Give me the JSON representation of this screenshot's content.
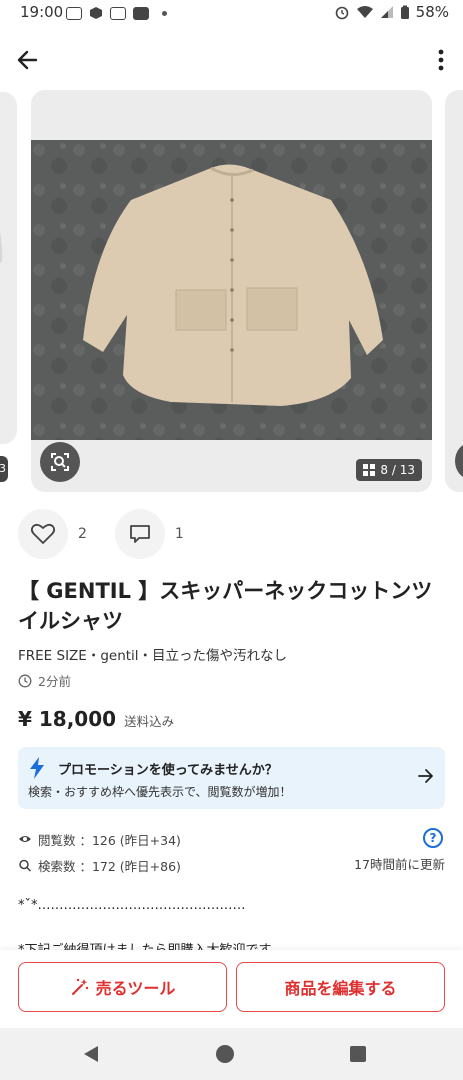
{
  "status_bar": {
    "time": "19:00",
    "battery": "58%"
  },
  "app_bar": {
    "back_icon": "arrow-left-icon",
    "more_icon": "more-vert-icon"
  },
  "carousel": {
    "prev_counter_fragment": "3",
    "counter": "8 / 13",
    "grid_icon": "grid-icon",
    "lens_icon": "image-search-icon"
  },
  "social": {
    "likes": "2",
    "comments": "1"
  },
  "item": {
    "title": "【 GENTIL 】スキッパーネックコットンツイルシャツ",
    "subinfo": "FREE SIZE・gentil・目立った傷や汚れなし",
    "posted": "2分前",
    "price": "¥ 18,000",
    "shipping": "送料込み"
  },
  "promo": {
    "title": "プロモーションを使ってみませんか？",
    "desc": "検索・おすすめ枠へ優先表示で、閲覧数が増加！"
  },
  "stats": {
    "views": "閲覧数 ：126 (昨日+34)",
    "searches": "検索数 ：172 (昨日+86)",
    "updated": "17時間前に更新"
  },
  "description": {
    "line1": "*ˇ*…………………………………………",
    "line2": "*下記ご納得頂けましたら即購入大歓迎です"
  },
  "actions": {
    "sell_tools": "売るツール",
    "edit_item": "商品を編集する"
  },
  "colors": {
    "accent_red": "#e02f2f",
    "promo_bg": "#e8f3fc",
    "promo_blue": "#1a6fd8"
  }
}
